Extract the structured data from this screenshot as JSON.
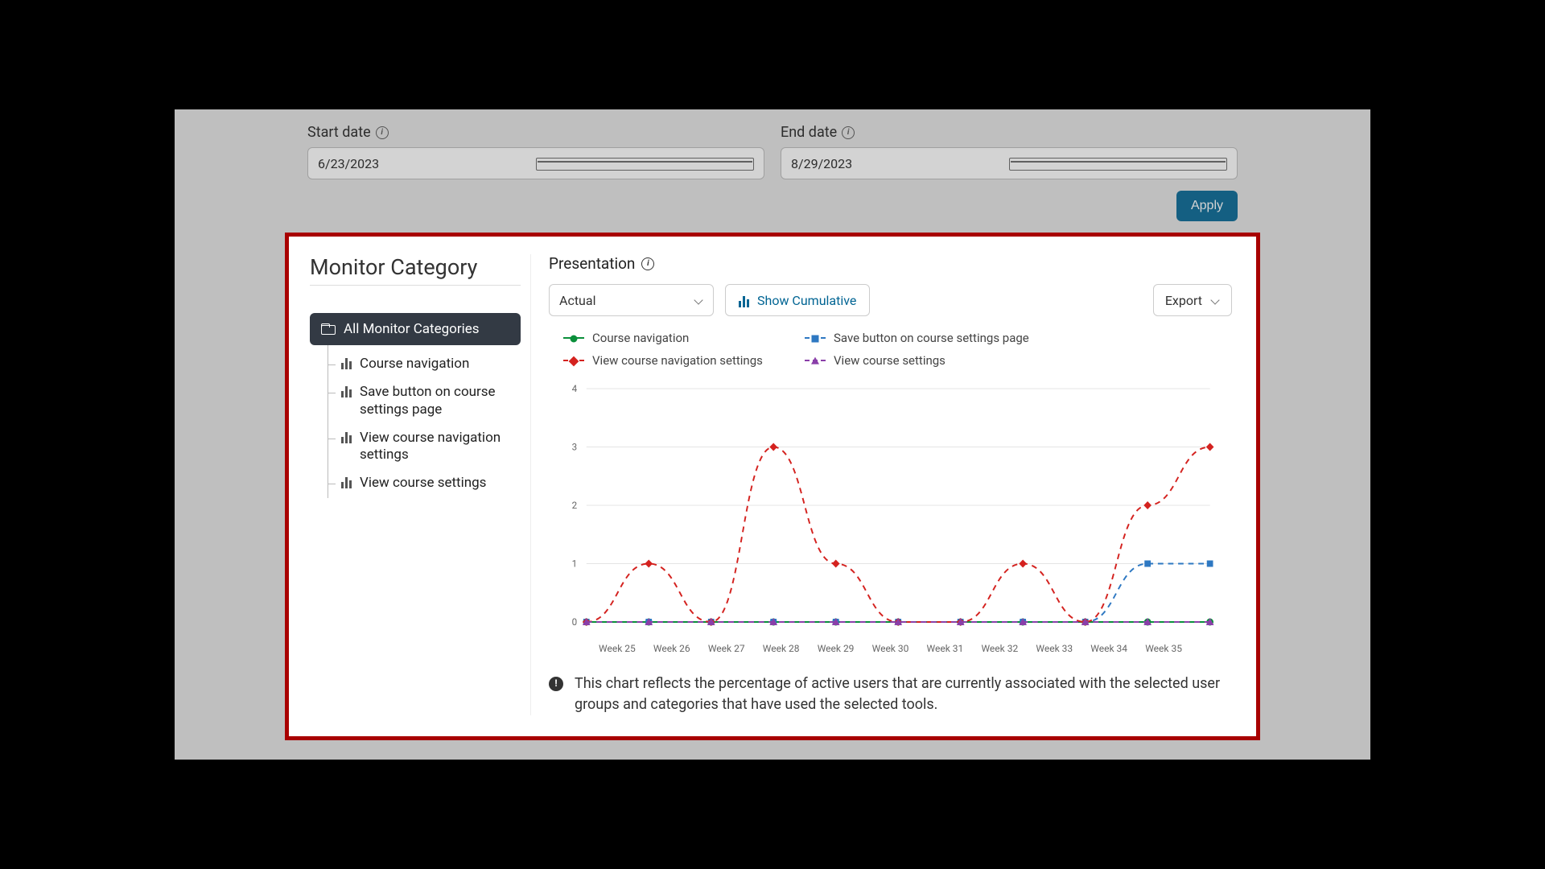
{
  "dates": {
    "start_label": "Start date",
    "start_value": "6/23/2023",
    "end_label": "End date",
    "end_value": "8/29/2023",
    "apply": "Apply"
  },
  "sidebar": {
    "title": "Monitor Category",
    "root": "All Monitor Categories",
    "items": [
      "Course navigation",
      "Save button on course settings page",
      "View course navigation settings",
      "View course settings"
    ]
  },
  "presentation": {
    "label": "Presentation",
    "mode": "Actual",
    "cumulative": "Show Cumulative",
    "export": "Export"
  },
  "legend": {
    "s1": "Course navigation",
    "s2": "Save button on course settings page",
    "s3": "View course navigation settings",
    "s4": "View course settings"
  },
  "colors": {
    "s1": "#0a8f3a",
    "s2": "#2e78c2",
    "s3": "#d4221f",
    "s4": "#8a3fa9"
  },
  "footnote": "This chart reflects the percentage of active users that are currently associated with the selected user groups and categories that have used the selected tools.",
  "chart_data": {
    "type": "line",
    "categories": [
      "Week 25",
      "Week 26",
      "Week 27",
      "Week 28",
      "Week 29",
      "Week 30",
      "Week 31",
      "Week 32",
      "Week 33",
      "Week 34",
      "Week 35"
    ],
    "ylim": [
      0,
      4
    ],
    "yticks": [
      0,
      1,
      2,
      3,
      4
    ],
    "series": [
      {
        "name": "Course navigation",
        "color": "#0a8f3a",
        "dash": false,
        "marker": "circle",
        "values": [
          0,
          0,
          0,
          0,
          0,
          0,
          0,
          0,
          0,
          0,
          0
        ]
      },
      {
        "name": "Save button on course settings page",
        "color": "#2e78c2",
        "dash": true,
        "marker": "square",
        "values": [
          0,
          0,
          0,
          0,
          0,
          0,
          0,
          0,
          0,
          1,
          1
        ]
      },
      {
        "name": "View course navigation settings",
        "color": "#d4221f",
        "dash": true,
        "marker": "diamond",
        "values": [
          0,
          1,
          0,
          3,
          1,
          0,
          0,
          1,
          0,
          2,
          3
        ]
      },
      {
        "name": "View course settings",
        "color": "#8a3fa9",
        "dash": true,
        "marker": "triangle",
        "values": [
          0,
          0,
          0,
          0,
          0,
          0,
          0,
          0,
          0,
          0,
          0
        ]
      }
    ]
  }
}
